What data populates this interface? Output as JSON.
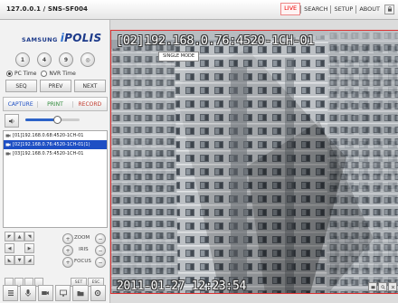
{
  "header": {
    "address": "127.0.0.1 / SNS-SF004",
    "nav": [
      {
        "label": "LIVE",
        "active": true
      },
      {
        "label": "SEARCH",
        "active": false
      },
      {
        "label": "SETUP",
        "active": false
      },
      {
        "label": "ABOUT",
        "active": false
      }
    ]
  },
  "sidebar": {
    "logo": {
      "brand": "SAMSUNG",
      "product_a": "i",
      "product_b": "POLIS"
    },
    "layout_buttons": [
      "1",
      "4",
      "9",
      "◎"
    ],
    "time_options": [
      {
        "label": "PC Time",
        "selected": true
      },
      {
        "label": "NVR Time",
        "selected": false
      }
    ],
    "seq_buttons": [
      "SEQ",
      "PREV",
      "NEXT"
    ],
    "record_buttons": [
      "CAPTURE",
      "PRINT",
      "RECORD"
    ],
    "volume_level": 0.58,
    "camera_list": [
      {
        "label": "[01]192.168.0.68:4520-1CH-01",
        "selected": false
      },
      {
        "label": "[02]192.168.0.76:4520-1CH-01(1)",
        "selected": true
      },
      {
        "label": "[03]192.168.0.75:4520-1CH-01",
        "selected": false
      }
    ],
    "ptz": {
      "zoom_label": "ZOOM",
      "iris_label": "IRIS",
      "focus_label": "FOCUS",
      "set_label": "SET",
      "esc_label": "ESC"
    }
  },
  "viewer": {
    "camera_title": "[02]192.168.0.76:4520-1CH-01",
    "mode_label": "SINGLE MODE",
    "timestamp": "2011-01-27 12:23:54"
  },
  "colors": {
    "accent": "#1e4fc4",
    "live": "#e00000",
    "viewer_border": "#dd3333"
  }
}
